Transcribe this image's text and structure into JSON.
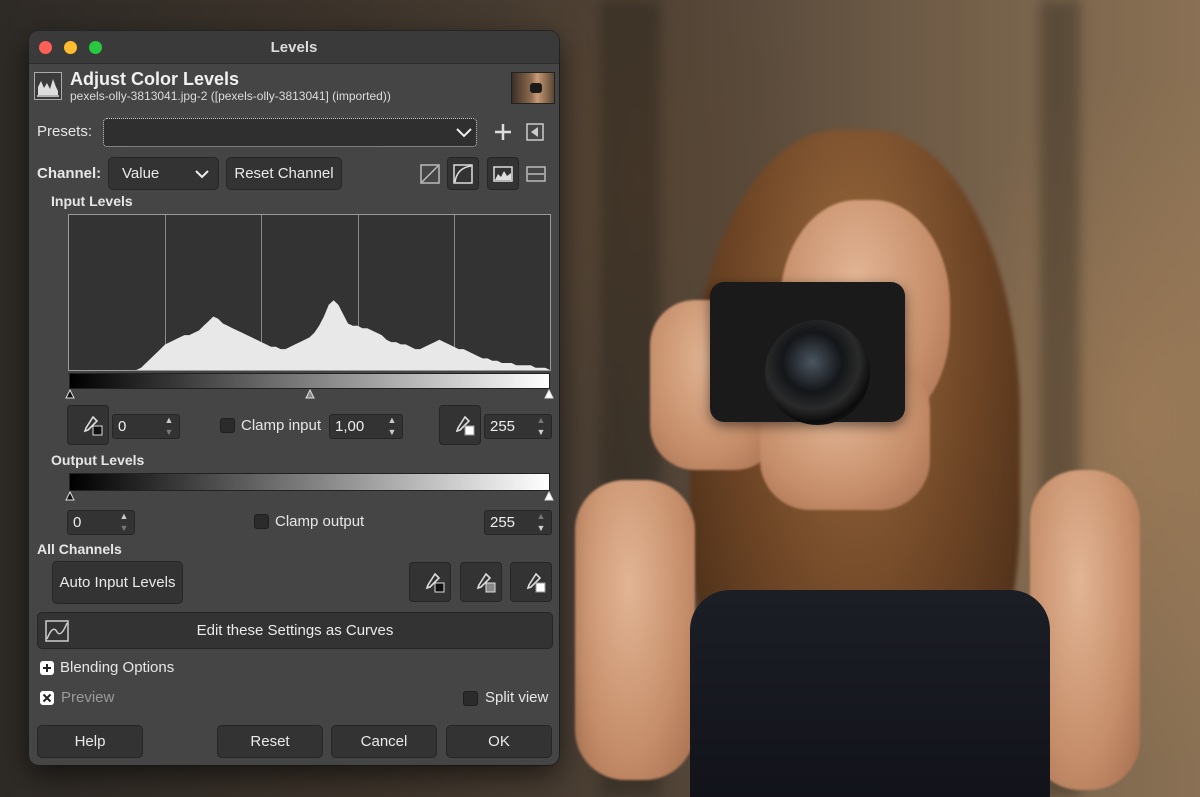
{
  "window": {
    "title": "Levels"
  },
  "header": {
    "heading": "Adjust Color Levels",
    "subtitle": "pexels-olly-3813041.jpg-2 ([pexels-olly-3813041] (imported))"
  },
  "presets": {
    "label": "Presets:",
    "value": ""
  },
  "channel": {
    "label": "Channel:",
    "value": "Value",
    "reset_label": "Reset Channel"
  },
  "input_levels": {
    "heading": "Input Levels",
    "low": "0",
    "gamma": "1,00",
    "high": "255",
    "clamp_label": "Clamp input",
    "clamp_checked": false
  },
  "output_levels": {
    "heading": "Output Levels",
    "low": "0",
    "high": "255",
    "clamp_label": "Clamp output",
    "clamp_checked": false
  },
  "all_channels": {
    "heading": "All Channels",
    "auto_label": "Auto Input Levels"
  },
  "curves_label": "Edit these Settings as Curves",
  "blending_label": "Blending Options",
  "preview": {
    "label": "Preview",
    "checked": true
  },
  "split_view": {
    "label": "Split view",
    "checked": false
  },
  "buttons": {
    "help": "Help",
    "reset": "Reset",
    "cancel": "Cancel",
    "ok": "OK"
  },
  "colors": {
    "window_bg": "#454545",
    "traffic_close": "#ff5f57",
    "traffic_min": "#febc2e",
    "traffic_max": "#28c840"
  },
  "icons": {
    "histogram": "levels-histogram-icon",
    "add": "plus-icon",
    "manage": "menu-triangle-icon",
    "linear": "linear-histogram-icon",
    "log": "log-histogram-icon",
    "curves": "curves-icon"
  },
  "chart_data": {
    "type": "area",
    "xlim": [
      0,
      255
    ],
    "grid": true,
    "values": [
      0,
      0,
      0,
      0,
      0,
      0,
      0,
      0,
      0,
      0,
      0,
      0,
      0,
      0,
      0,
      1,
      3,
      5,
      7,
      9,
      11,
      12,
      13,
      14,
      15,
      15,
      16,
      17,
      19,
      21,
      23,
      22,
      20,
      19,
      18,
      17,
      16,
      15,
      14,
      13,
      12,
      11,
      10,
      10,
      9,
      9,
      10,
      11,
      12,
      13,
      14,
      16,
      19,
      23,
      28,
      30,
      28,
      24,
      20,
      19,
      19,
      18,
      18,
      17,
      16,
      15,
      13,
      12,
      12,
      11,
      11,
      10,
      9,
      9,
      10,
      11,
      12,
      13,
      12,
      11,
      10,
      9,
      9,
      8,
      7,
      6,
      5,
      5,
      4,
      4,
      3,
      3,
      3,
      2,
      2,
      2,
      2,
      1,
      1,
      1,
      0
    ]
  }
}
